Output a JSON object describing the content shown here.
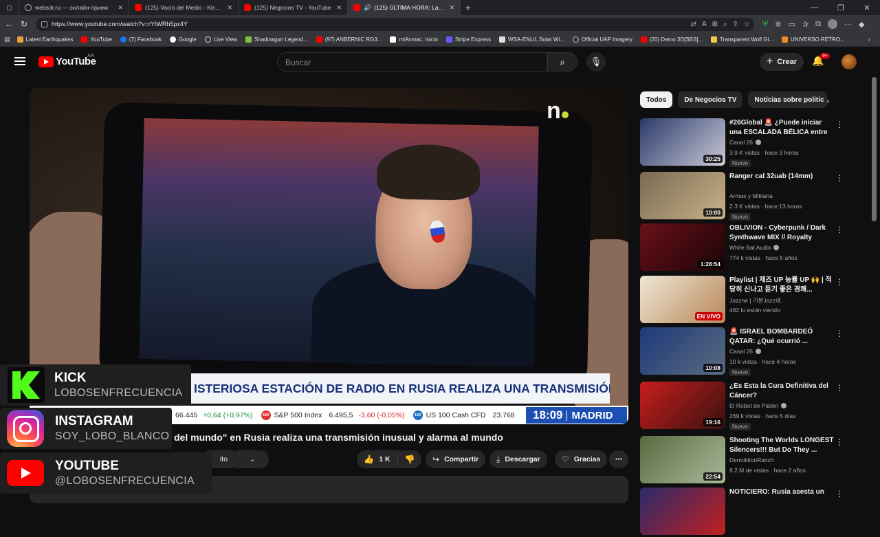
{
  "browser": {
    "tabs": [
      {
        "title": "websdr.ru — онлайн-прием",
        "icon": "globe-icon"
      },
      {
        "title": "(125) Vacío del Medio - Kish (ÁLB",
        "icon": "youtube-icon"
      },
      {
        "title": "(125) Negocios TV - YouTube",
        "icon": "youtube-icon"
      },
      {
        "title": "(125) ÚLTIMA HORA: La \"radio",
        "icon": "youtube-icon"
      }
    ],
    "url": "https://www.youtube.com/watch?v=rYtWRh5pz4Y",
    "bookmarks": [
      {
        "label": "Latest Earthquakes",
        "color": "#e8a33d"
      },
      {
        "label": "YouTube",
        "color": "#ff0000"
      },
      {
        "label": "(7) Facebook",
        "color": "#1877f2"
      },
      {
        "label": "Google",
        "color": "#ffffff"
      },
      {
        "label": "Live View",
        "color": "#dddddd"
      },
      {
        "label": "Shadowgun Legend...",
        "color": "#7cc242"
      },
      {
        "label": "(97) ANBERNIC RG3...",
        "color": "#ff0000"
      },
      {
        "label": "miAnmac. Inicio",
        "color": "#ffffff"
      },
      {
        "label": "Stripe Express",
        "color": "#635bff"
      },
      {
        "label": "WSA-ENLIL Solar Wi...",
        "color": "#dddddd"
      },
      {
        "label": "Official UAP Imagery",
        "color": "#bbbbbb"
      },
      {
        "label": "(20) Demo 3D[SBS]...",
        "color": "#ff0000"
      },
      {
        "label": "Transparent Wolf Gl...",
        "color": "#f2c94c"
      },
      {
        "label": "UNIVERSO RETRO...",
        "color": "#f08a24"
      }
    ]
  },
  "youtube": {
    "logo_text": "YouTube",
    "country": "AR",
    "search_placeholder": "Buscar",
    "create_label": "Crear",
    "notif_count": "9+"
  },
  "video": {
    "overlay_headline": "ISTERIOSA ESTACIÓN DE RADIO EN RUSIA REALIZA UNA TRANSMISIÓN INUSUAL",
    "ticker": [
      {
        "value": "66.445",
        "change": "+0,64 (+0,97%)",
        "dir": "pos"
      },
      {
        "name": "S&P 500 Index",
        "value": "6.495,5",
        "change": "-3,60 (-0,05%)",
        "dir": "neg",
        "badge": "500"
      },
      {
        "name": "US 100 Cash CFD",
        "value": "23.768",
        "badge": "100"
      }
    ],
    "clock_time": "18:09",
    "clock_city": "MADRID",
    "channel_mark": "n",
    "title": "del mundo\" en Rusia realiza una transmisión inusual y alarma al mundo",
    "subscribe_label": "ito",
    "like_count": "1 K",
    "share_label": "Compartir",
    "download_label": "Descargar",
    "thanks_label": "Gracias"
  },
  "social": [
    {
      "label": "KICK",
      "handle": "LOBOSENFRECUENCIA"
    },
    {
      "label": "INSTAGRAM",
      "handle": "SOY_LOBO_BLANCO"
    },
    {
      "label": "YOUTUBE",
      "handle": "@LOBOSENFRECUENCIA"
    }
  ],
  "sidebar": {
    "chips": [
      "Todos",
      "De Negocios TV",
      "Noticias sobre politic"
    ],
    "items": [
      {
        "title": "#26Global 🚨 ¿Puede iniciar una ESCALADA BÉLICA entre ...",
        "channel": "Canal 26",
        "verified": true,
        "meta": "3.9 K vistas · hace 3 horas",
        "badge": "Nuevo",
        "duration": "30:25",
        "colors": [
          "#2b3a6a",
          "#c9c9d6"
        ]
      },
      {
        "title": "Ranger cal 32uab (14mm)",
        "channel": "Armas y Militaria",
        "verified": false,
        "meta": "2.3 K vistas · hace 13 horas",
        "badge": "Nuevo",
        "duration": "10:00",
        "colors": [
          "#7a6a52",
          "#c7b38a"
        ]
      },
      {
        "title": "OBLIVION - Cyberpunk / Dark Synthwave MIX // Royalty Free...",
        "channel": "White Bat Audio",
        "verified": true,
        "meta": "774 k vistas · hace 5 años",
        "badge": "",
        "duration": "1:28:54",
        "colors": [
          "#6a0f18",
          "#1a0508"
        ]
      },
      {
        "title": "Playlist | 재즈 UP 능률 UP 🙌 | 적당히 신나고 듣기 좋은 경쾌...",
        "channel": "Jazzne | 기분Jazz네",
        "verified": false,
        "meta": "482 lo están viendo",
        "badge": "",
        "duration": "EN VIVO",
        "colors": [
          "#efe6d6",
          "#b9875a"
        ]
      },
      {
        "title": "🚨 ISRAEL BOMBARDEÓ QATAR: ¿Qué ocurrió ...",
        "channel": "Canal 26",
        "verified": true,
        "meta": "10 k vistas · hace 4 horas",
        "badge": "Nuevo",
        "duration": "10:08",
        "colors": [
          "#1e3a7a",
          "#5a6a80"
        ]
      },
      {
        "title": "¿Es Esta la Cura Definitiva del Cáncer?",
        "channel": "El Robot de Platón",
        "verified": true,
        "meta": "269 k vistas · hace 5 días",
        "badge": "Nuevo",
        "duration": "19:16",
        "colors": [
          "#c81e1e",
          "#3a1010"
        ]
      },
      {
        "title": "Shooting The Worlds LONGEST Silencers!!! But Do They ...",
        "channel": "DemolitionRanch",
        "verified": false,
        "meta": "8.2 M de vistas · hace 2 años",
        "badge": "",
        "duration": "22:54",
        "colors": [
          "#5a6a40",
          "#a9b99a"
        ]
      },
      {
        "title": "NOTICIERO: Rusia asesta un",
        "channel": "",
        "verified": false,
        "meta": "",
        "badge": "",
        "duration": "",
        "colors": [
          "#2a2a6a",
          "#c02020"
        ]
      }
    ]
  }
}
